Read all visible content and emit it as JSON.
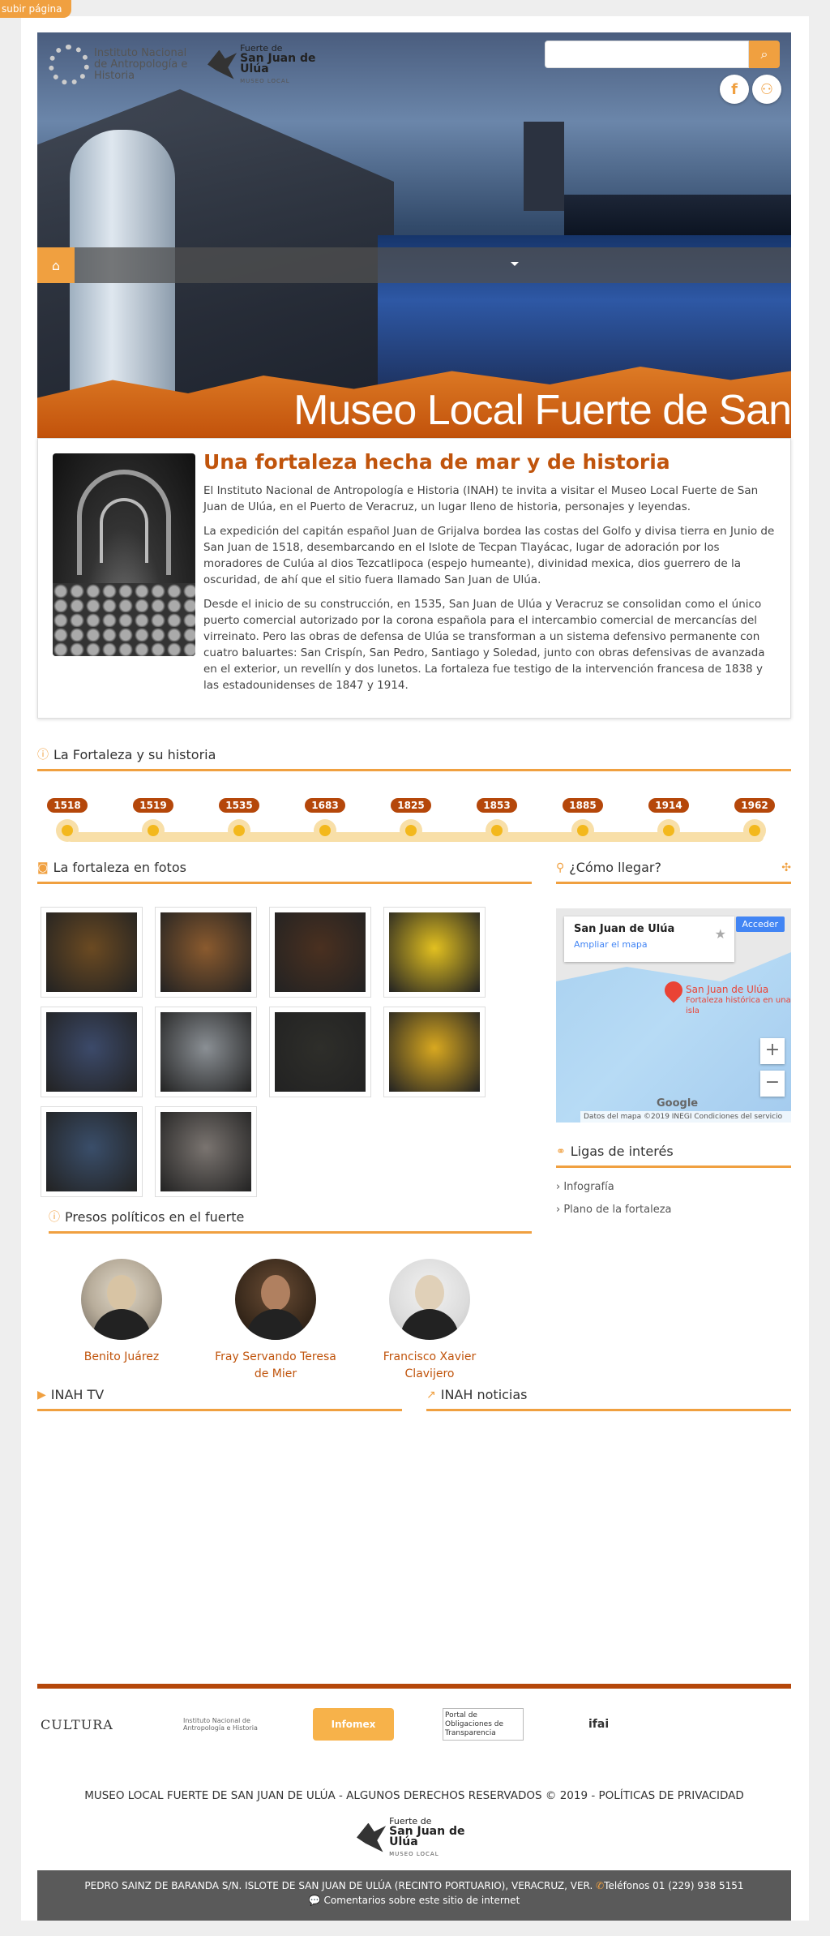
{
  "top_tab": "subir página",
  "header": {
    "inah_logo": "Instituto Nacional de Antropología e Historia",
    "museum_logo_small": "Fuerte de",
    "museum_logo_big": "San Juan de Ulúa",
    "museum_logo_sub": "MUSEO LOCAL",
    "search": {
      "placeholder": "",
      "value": "",
      "icon": "search-icon"
    },
    "social": [
      "facebook-icon",
      "sitemap-icon"
    ],
    "hero_title": "Museo Local Fuerte de San",
    "home_icon": "home-icon"
  },
  "intro": {
    "title": "Una fortaleza hecha de mar y de historia",
    "paragraphs": [
      "El Instituto Nacional de Antropología e Historia (INAH) te invita a visitar el Museo Local Fuerte de San Juan de Ulúa, en el Puerto de Veracruz, un lugar lleno de historia, personajes y leyendas.",
      "La expedición del capitán español Juan de Grijalva bordea las costas del Golfo y divisa tierra en Junio de San Juan de 1518, desembarcando en el Islote de Tecpan Tlayácac, lugar de adoración por los moradores de Culúa al dios Tezcatlipoca (espejo humeante), divinidad mexica, dios guerrero de la oscuridad, de ahí que el sitio fuera llamado San Juan de Ulúa.",
      "Desde el inicio de su construcción, en 1535, San Juan de Ulúa y Veracruz se consolidan como el único puerto comercial autorizado por la corona española para el intercambio comercial de mercancías del virreinato. Pero las obras de defensa de Ulúa se transforman a un sistema defensivo permanente con cuatro baluartes: San Crispín, San Pedro, Santiago y Soledad, junto con obras defensivas de avanzada en el exterior, un revellín y dos lunetos. La fortaleza fue testigo de la intervención francesa de 1838 y las estadounidenses de 1847 y 1914."
    ]
  },
  "timeline": {
    "title": "La Fortaleza y su historia",
    "years": [
      "1518",
      "1519",
      "1535",
      "1683",
      "1825",
      "1853",
      "1885",
      "1914",
      "1962"
    ]
  },
  "photos": {
    "title": "La fortaleza en fotos",
    "colors": [
      "#6b4a22",
      "#8a5a2e",
      "#4a3020",
      "#e2c020",
      "#3c4a6a",
      "#8a8f94",
      "#2e2e2a",
      "#d8a820",
      "#3a4e6a",
      "#7a7470"
    ]
  },
  "map": {
    "title": "¿Cómo llegar?",
    "place": "San Juan de Ulúa",
    "enlarge": "Ampliar el mapa",
    "login": "Acceder",
    "pin_label": "San Juan de Ulúa",
    "pin_sub": "Fortaleza histórica en una isla",
    "zoom_in": "+",
    "zoom_out": "−",
    "attribution": "Datos del mapa ©2019 INEGI   Condiciones del servicio",
    "google": "Google"
  },
  "links": {
    "title": "Ligas de interés",
    "items": [
      "Infografía",
      "Plano de la fortaleza"
    ]
  },
  "presos": {
    "title": "Presos políticos en el fuerte",
    "people": [
      "Benito Juárez",
      "Fray Servando Teresa de Mier",
      "Francisco Xavier Clavijero"
    ]
  },
  "tv": {
    "title": "INAH TV"
  },
  "news": {
    "title": "INAH noticias"
  },
  "partners": [
    "CULTURA",
    "Instituto Nacional de Antropología e Historia",
    "Infomex",
    "Portal de Obligaciones de Transparencia",
    "ifai"
  ],
  "rights": "MUSEO LOCAL FUERTE DE SAN JUAN DE ULÚA - ALGUNOS DERECHOS RESERVADOS © 2019 - POLÍTICAS DE PRIVACIDAD",
  "address": {
    "line": "PEDRO SAINZ DE BARANDA S/N. ISLOTE DE SAN JUAN DE ULÚA (RECINTO PORTUARIO), VERACRUZ, VER.",
    "phone": "Teléfonos 01 (229) 938 5151",
    "comments": "Comentarios sobre este sitio de internet"
  }
}
